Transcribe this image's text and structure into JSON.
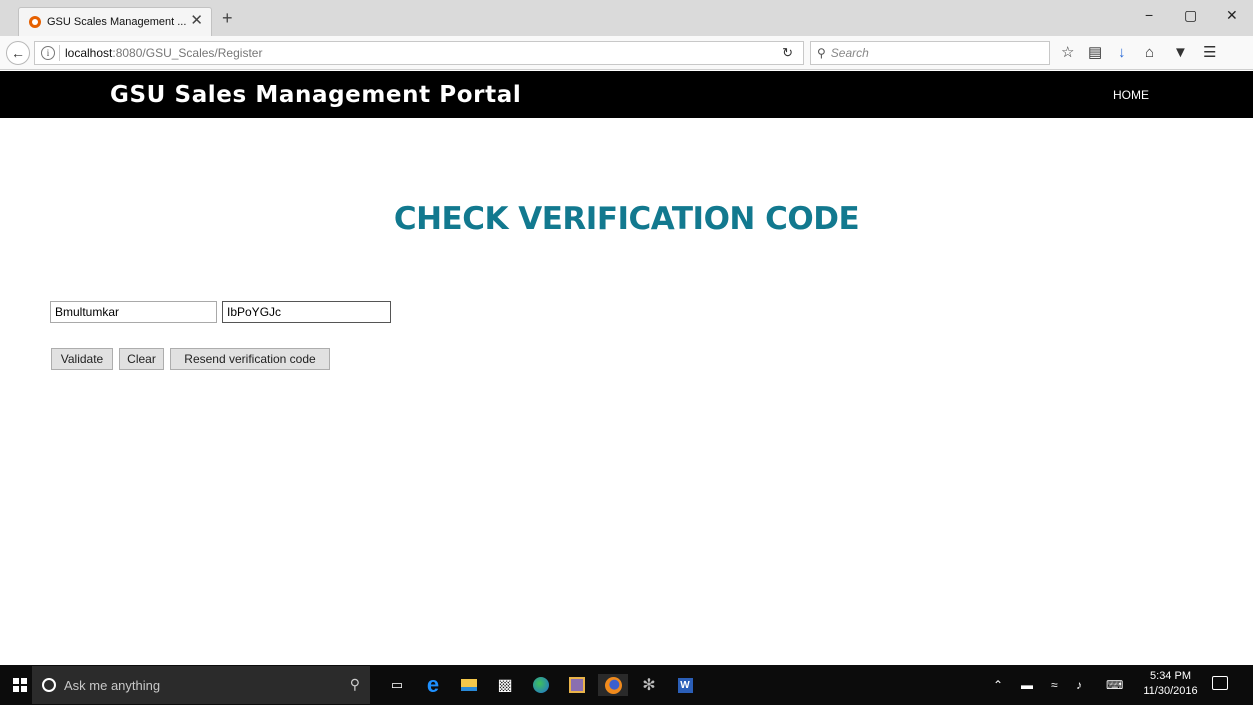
{
  "browser": {
    "tab_title": "GSU Scales Management ...",
    "tab_close": "✕",
    "new_tab": "+",
    "url_host": "localhost",
    "url_path": ":8080/GSU_Scales/Register",
    "search_placeholder": "Search",
    "icons": [
      "back-arrow-icon",
      "info-icon",
      "reload-icon",
      "search-icon",
      "bookmark-star-icon",
      "reading-list-icon",
      "download-icon",
      "home-icon",
      "pocket-icon",
      "menu-icon"
    ],
    "window_controls": [
      "−",
      "▢",
      "✕"
    ]
  },
  "site": {
    "title": "GSU  Sales Management Portal",
    "nav_home": "HOME",
    "header_bg": "#000000"
  },
  "main": {
    "heading": "CHECK VERIFICATION CODE",
    "heading_color": "#12798f",
    "username_value": "Bmultumkar",
    "code_value": "IbPoYGJc",
    "buttons": {
      "validate": "Validate",
      "clear": "Clear",
      "resend": "Resend verification code"
    }
  },
  "taskbar": {
    "search_placeholder": "Ask me anything",
    "apps": [
      "task-view-icon",
      "edge-icon",
      "file-explorer-icon",
      "store-icon",
      "browser-globe-icon",
      "app-icon",
      "firefox-icon",
      "paint-icon",
      "word-icon"
    ],
    "time": "5:34 PM",
    "date": "11/30/2016"
  }
}
